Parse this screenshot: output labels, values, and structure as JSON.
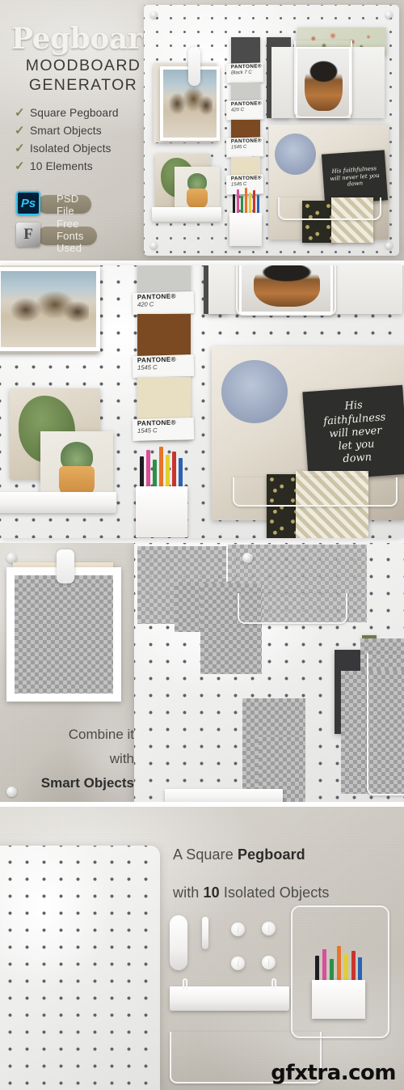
{
  "product": {
    "title": "Pegboard",
    "subtitle_line1": "MOODBOARD",
    "subtitle_line2": "GENERATOR",
    "features": [
      {
        "label": "Square Pegboard",
        "check": "check-icon"
      },
      {
        "label": "Smart Objects",
        "check": "check-icon"
      },
      {
        "label": "Isolated Objects",
        "check": "check-icon"
      },
      {
        "label": "10 Elements",
        "check": "check-icon"
      }
    ],
    "badges": [
      {
        "icon": "photoshop-icon",
        "glyph": "Ps",
        "label": "PSD File"
      },
      {
        "icon": "font-file-icon",
        "glyph": "F",
        "label": "Free Fonts Used"
      }
    ],
    "accent_olive": "#7e8550",
    "accent_cyan": "#31c5f0",
    "badge_fill": "#968e78"
  },
  "moodboard": {
    "pantone_chips": [
      {
        "name": "PANTONE",
        "reg": "®",
        "code": "Black 7 C",
        "color": "#4b4b4b"
      },
      {
        "name": "PANTONE",
        "reg": "®",
        "code": "420 C",
        "color": "#c9c9c7"
      },
      {
        "name": "PANTONE",
        "reg": "®",
        "code": "1545 C",
        "color": "#7b4a22"
      },
      {
        "name": "PANTONE",
        "reg": "®",
        "code": "1545 C",
        "color": "#e6dcbc"
      }
    ],
    "chalkboard_quote": "His faithfulness will never let you down",
    "photos": [
      {
        "name": "beach-rocks-photo"
      },
      {
        "name": "monstera-leaf-photo"
      },
      {
        "name": "succulent-pot-photo"
      },
      {
        "name": "woman-hat-photo"
      },
      {
        "name": "floral-photo"
      },
      {
        "name": "cozy-interior-photo"
      }
    ]
  },
  "panel2": {
    "pantone_chips": [
      {
        "name": "PANTONE",
        "reg": "®",
        "code": "420 C"
      },
      {
        "name": "PANTONE",
        "reg": "®",
        "code": "1545 C"
      },
      {
        "name": "PANTONE",
        "reg": "®",
        "code": "1545 C"
      }
    ],
    "chalkboard_quote_lines": [
      "His",
      "faithfulness",
      "will never",
      "let you",
      "down"
    ]
  },
  "panel3": {
    "caption_line1": "Combine it",
    "caption_line2": "with",
    "caption_line3": "Smart Objects"
  },
  "panel4": {
    "headline_pre": "A Square ",
    "headline_bold": "Pegboard",
    "subline_pre": "with ",
    "subline_bold": "10",
    "subline_post": " Isolated Objects",
    "objects": [
      "peg-knob",
      "peg-knob",
      "peg-knob",
      "peg-knob",
      "cap-pill",
      "peg-bar",
      "shelf-bin",
      "wire-rack-large",
      "pencil-holder",
      "wire-rack-small"
    ]
  },
  "watermark": {
    "text": "gfxtra.com"
  }
}
